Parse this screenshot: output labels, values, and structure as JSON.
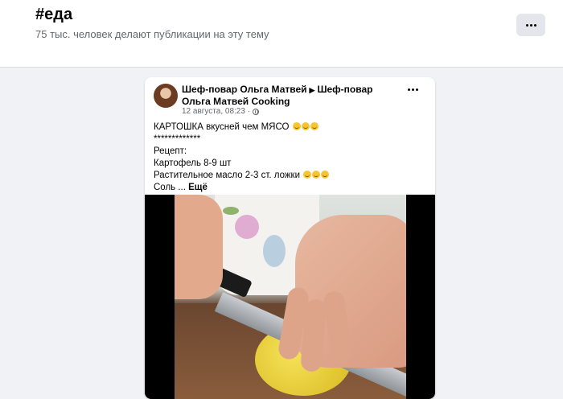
{
  "header": {
    "hashtag": "#еда",
    "subtitle": "75 тыс. человек делают публикации на эту тему",
    "more_icon": "more-horizontal-icon"
  },
  "post": {
    "author": "Шеф-повар Ольга Матвей",
    "separator": "▶",
    "page": "Шеф-повар Ольга Матвей Cooking",
    "date": "12 августа, 08:23",
    "privacy_icon": "globe-icon",
    "lines": [
      "КАРТОШКА вкусней чем МЯСО",
      "*************",
      "Рецепт:",
      "Картофель 8-9 шт",
      "Растительное масло 2-3 ст. ложки",
      "Соль ..."
    ],
    "see_more": "Ещё",
    "emoji_icon": "grinning-face-emoji"
  }
}
